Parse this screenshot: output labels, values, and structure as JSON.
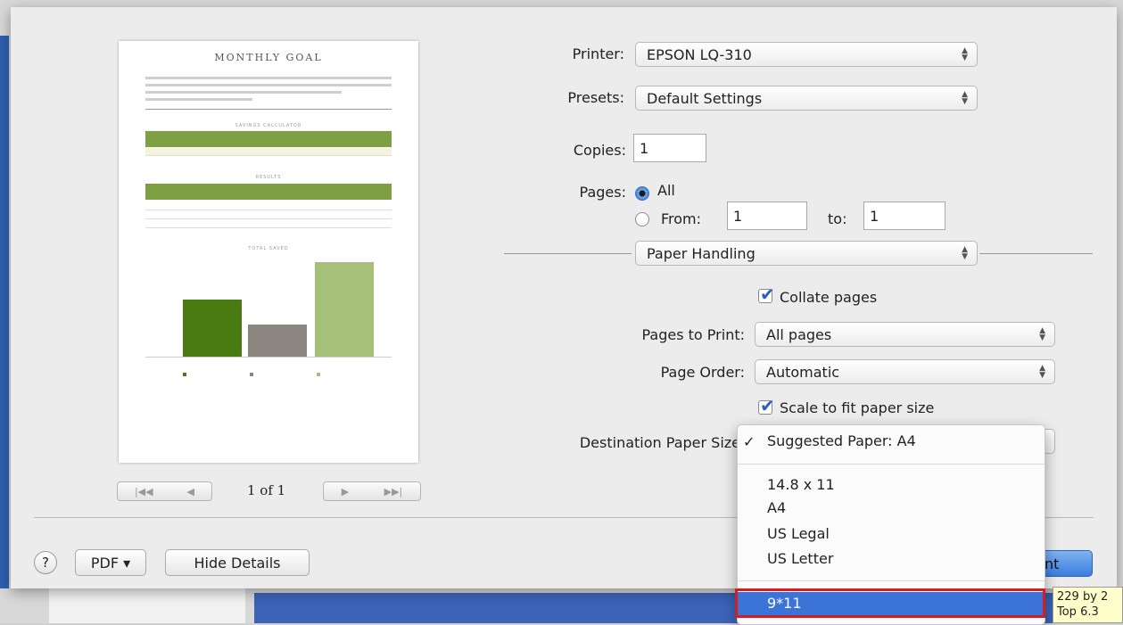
{
  "thumbnail": {
    "doc_title": "MONTHLY GOAL",
    "section_savings": "SAVINGS CALCULATOR",
    "section_results": "RESULTS",
    "section_total": "TOTAL SAVED",
    "bar_values": [
      0.6,
      0.34,
      1.0
    ],
    "bar_colors": [
      "#4a7a12",
      "#8b8680",
      "#a6c07a"
    ]
  },
  "page_nav": {
    "first_icon": "first-page-icon",
    "prev_icon": "prev-page-icon",
    "next_icon": "next-page-icon",
    "last_icon": "last-page-icon",
    "count": "1 of 1"
  },
  "printer": {
    "label": "Printer:",
    "value": "EPSON LQ-310"
  },
  "presets": {
    "label": "Presets:",
    "value": "Default Settings"
  },
  "copies": {
    "label": "Copies:",
    "value": "1"
  },
  "pages": {
    "label": "Pages:",
    "all_label": "All",
    "from_label": "From:",
    "from_value": "1",
    "to_label": "to:",
    "to_value": "1"
  },
  "section_popup": {
    "value": "Paper Handling"
  },
  "collate": {
    "label": "Collate pages",
    "checked": true
  },
  "pages_to_print": {
    "label": "Pages to Print:",
    "value": "All pages"
  },
  "page_order": {
    "label": "Page Order:",
    "value": "Automatic"
  },
  "scale_fit": {
    "label": "Scale to fit paper size",
    "checked": true
  },
  "dest_paper": {
    "label": "Destination Paper Size"
  },
  "paper_menu": {
    "checkmark": "✓",
    "suggested": "Suggested Paper: A4",
    "items": [
      "14.8 x 11",
      "A4",
      "US Legal",
      "US Letter"
    ],
    "highlighted": "9*11"
  },
  "footer": {
    "help": "?",
    "pdf": "PDF ▾",
    "hide_details": "Hide Details",
    "print": "nt"
  },
  "tooltip": {
    "line1": "229 by 2",
    "line2": "Top 6.3"
  },
  "colors": {
    "accent": "#3b74d6",
    "highlight_border": "#d21d25",
    "chart_green": "#7ea043"
  }
}
